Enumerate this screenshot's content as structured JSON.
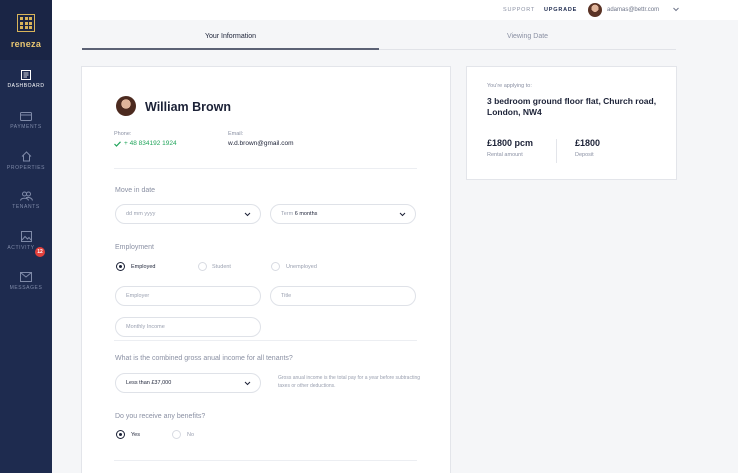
{
  "brand": {
    "name": "reneza"
  },
  "sidebar": {
    "items": [
      {
        "label": "DASHBOARD",
        "icon": "dashboard-icon",
        "active": true
      },
      {
        "label": "PAYMENTS",
        "icon": "card-icon",
        "active": false
      },
      {
        "label": "PROPERTIES",
        "icon": "home-icon",
        "active": false
      },
      {
        "label": "TENANTS",
        "icon": "users-icon",
        "active": false
      },
      {
        "label": "ACTIVITY",
        "icon": "image-icon",
        "active": false,
        "badge": "12"
      },
      {
        "label": "MESSAGES",
        "icon": "mail-icon",
        "active": false
      }
    ]
  },
  "topbar": {
    "support": "SUPPORT",
    "upgrade": "UPGRADE",
    "email": "adamas@bettr.com"
  },
  "tabs": [
    {
      "label": "Your Information",
      "active": true
    },
    {
      "label": "Viewing Date",
      "active": false
    }
  ],
  "profile": {
    "name": "William Brown",
    "phone_label": "Phone:",
    "phone": "+ 48 834192 1924",
    "email_label": "Email:",
    "email": "w.d.brown@gmail.com"
  },
  "move_in": {
    "label": "Move in date",
    "date_placeholder": "dd mm yyyy",
    "term_prefix": "Term",
    "term_value": "6 months"
  },
  "employment": {
    "label": "Employment",
    "options": [
      {
        "label": "Employed",
        "selected": true
      },
      {
        "label": "Student",
        "selected": false
      },
      {
        "label": "Unemployed",
        "selected": false
      }
    ],
    "employer_placeholder": "Employer",
    "title_placeholder": "Title",
    "income_placeholder": "Monthly Income"
  },
  "income": {
    "question": "What is the combined gross anual income for all tenants?",
    "selected": "Less than £37,000",
    "hint": "Gross anual income is the total pay for a year before subtracting taxes or other deductions."
  },
  "benefits": {
    "question": "Do you receive any benefits?",
    "options": [
      {
        "label": "Yes",
        "selected": true
      },
      {
        "label": "No",
        "selected": false
      }
    ]
  },
  "summary": {
    "applying_label": "You're applying to:",
    "property": "3 bedroom ground floor flat, Church road, London, NW4",
    "rent_value": "£1800 pcm",
    "rent_label": "Rental amount",
    "deposit_value": "£1800",
    "deposit_label": "Deposit"
  },
  "colors": {
    "sidebar": "#1e2b4f",
    "accent_gold": "#d8b45a",
    "success_green": "#21a55b",
    "badge_red": "#e2403c"
  }
}
